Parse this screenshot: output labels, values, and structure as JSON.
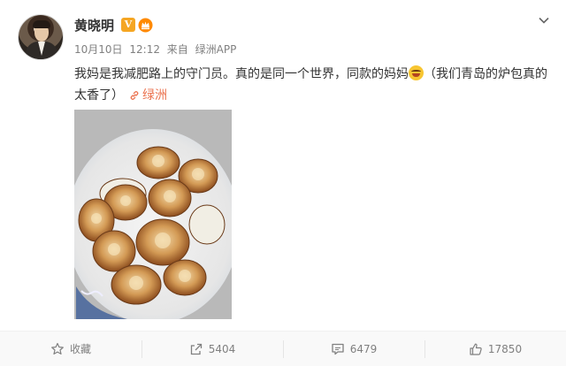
{
  "post": {
    "author": "黄晓明",
    "verified_badge": "V",
    "meta": {
      "date": "10月10日",
      "time": "12:12",
      "source_prefix": "来自",
      "source": "绿洲APP"
    },
    "text_part1": "我妈是我减肥路上的守门员。真的是同一个世界，同款的妈妈",
    "text_part2": "（我们青岛的炉包真的太香了）",
    "link_text": "绿洲",
    "accent_color": "#eb7350"
  },
  "actions": {
    "favorite_label": "收藏",
    "repost_count": "5404",
    "comment_count": "6479",
    "like_count": "17850"
  }
}
